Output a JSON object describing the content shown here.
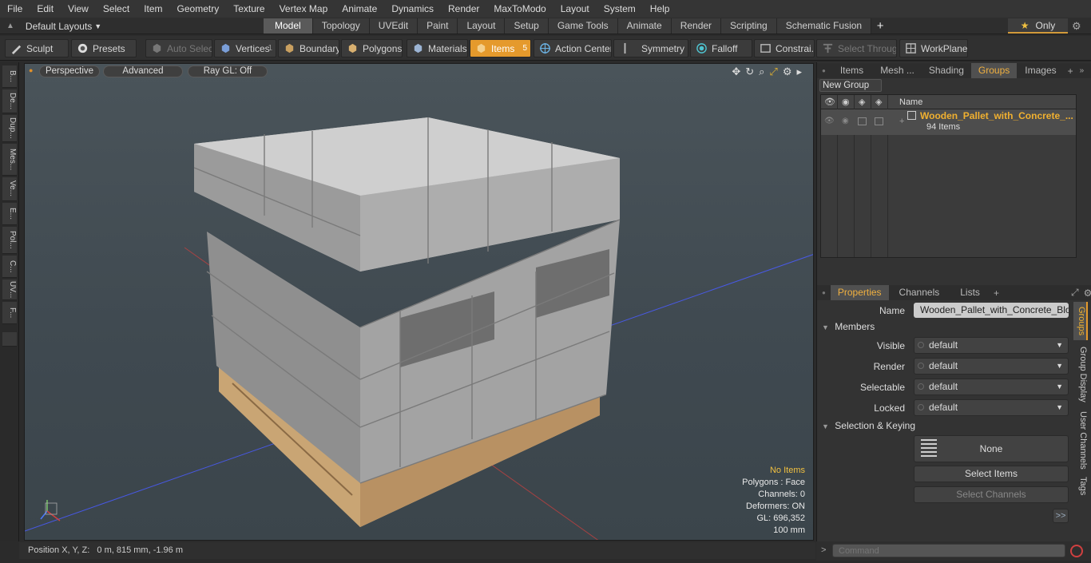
{
  "menu": [
    "File",
    "Edit",
    "View",
    "Select",
    "Item",
    "Geometry",
    "Texture",
    "Vertex Map",
    "Animate",
    "Dynamics",
    "Render",
    "MaxToModo",
    "Layout",
    "System",
    "Help"
  ],
  "layout_selector": "Default Layouts",
  "tabs": [
    "Model",
    "Topology",
    "UVEdit",
    "Paint",
    "Layout",
    "Setup",
    "Game Tools",
    "Animate",
    "Render",
    "Scripting",
    "Schematic Fusion"
  ],
  "active_tab": "Model",
  "only_label": "Only",
  "toolbar": {
    "sculpt": "Sculpt",
    "presets": "Presets",
    "auto_select": "Auto Select",
    "vertices": "Vertices",
    "vertices_count": "1",
    "boundary": "Boundary",
    "polygons": "Polygons",
    "materials": "Materials",
    "items": "Items",
    "items_count": "5",
    "action_center": "Action Center",
    "symmetry": "Symmetry",
    "falloff": "Falloff",
    "constraints": "Constrai...",
    "select_through": "Select Through",
    "workplane": "WorkPlane"
  },
  "left_tabs": [
    "B...",
    "De...",
    "Dup...",
    "Mes...",
    "Ve...",
    "E...",
    "Pol...",
    "C...",
    "UV...",
    "F..."
  ],
  "viewport": {
    "perspective": "Perspective",
    "advanced": "Advanced",
    "raygl": "Ray GL: Off",
    "stats": {
      "no_items": "No Items",
      "polygons": "Polygons : Face",
      "channels": "Channels: 0",
      "deformers": "Deformers: ON",
      "gl": "GL: 696,352",
      "scale": "100 mm"
    }
  },
  "status": "Position X, Y, Z:   0 m, 815 mm, -1.96 m",
  "upper_panel": {
    "tabs": [
      "Items",
      "Mesh ...",
      "Shading",
      "Groups",
      "Images"
    ],
    "active_tab": "Groups",
    "new_group": "New Group",
    "col_name": "Name",
    "group_name": "Wooden_Pallet_with_Concrete_...",
    "group_count": "94 Items"
  },
  "properties": {
    "tabs": [
      "Properties",
      "Channels",
      "Lists"
    ],
    "active_tab": "Properties",
    "name_label": "Name",
    "name_value": "Wooden_Pallet_with_Concrete_Blocks",
    "members": "Members",
    "visible_label": "Visible",
    "visible_value": "default",
    "render_label": "Render",
    "render_value": "default",
    "selectable_label": "Selectable",
    "selectable_value": "default",
    "locked_label": "Locked",
    "locked_value": "default",
    "selection_keying": "Selection & Keying",
    "none_btn": "None",
    "select_items": "Select Items",
    "select_channels": "Select Channels",
    "more": ">>",
    "side_tabs": [
      "Groups",
      "Group Display",
      "User Channels",
      "Tags"
    ]
  },
  "command_placeholder": "Command"
}
